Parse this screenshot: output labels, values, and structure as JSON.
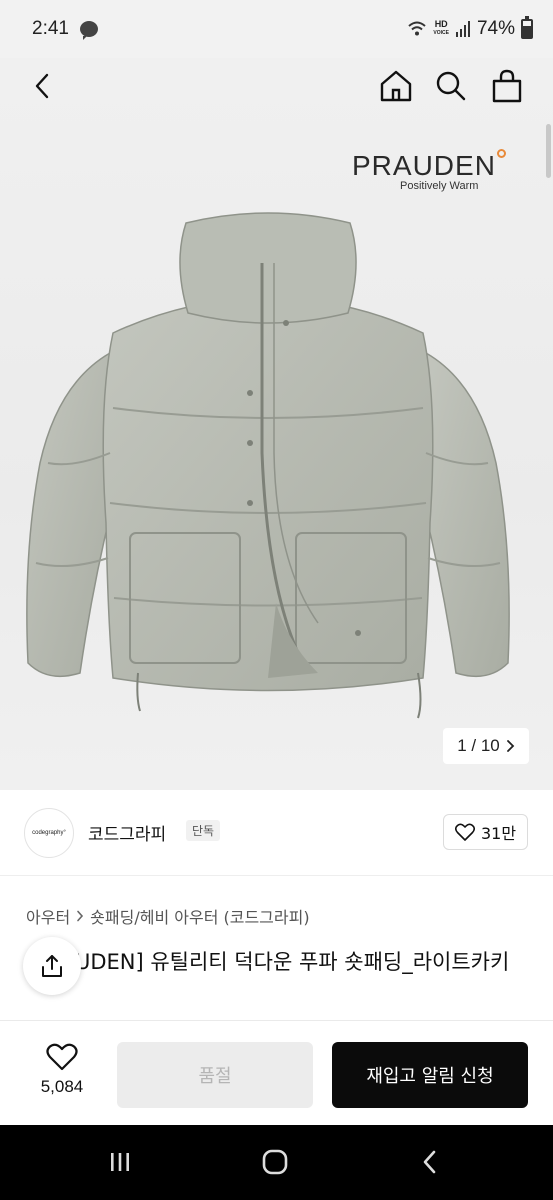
{
  "status_bar": {
    "time": "2:41",
    "talk_badge": "TALK",
    "network": "HD",
    "network_sub": "VOICE",
    "battery": "74%",
    "icons": [
      "wifi-icon",
      "signal-icon",
      "battery-icon"
    ]
  },
  "nav": {
    "icons": [
      "back-arrow-icon",
      "home-icon",
      "search-icon",
      "shopping-bag-icon"
    ]
  },
  "hero": {
    "brand_name": "PRAUDEN",
    "brand_tagline": "Positively Warm",
    "page_indicator": "1 / 10",
    "image_alt": "jacket"
  },
  "seller": {
    "avatar_text": "codegraphy°",
    "name": "코드그라피",
    "badge": "단독",
    "likes": "31만"
  },
  "product": {
    "breadcrumb": [
      "아우터",
      "숏패딩/헤비 아우터 (코드그라피)"
    ],
    "title": "[PRAUDEN] 유틸리티 덕다운 푸파 숏패딩_라이트카키"
  },
  "actions": {
    "wish_count": "5,084",
    "soldout_label": "품절",
    "restock_label": "재입고 알림 신청"
  },
  "colors": {
    "primary_button": "#0b0b0b",
    "disabled_button": "#ececec",
    "jacket": "#b6bab1",
    "brand_accent": "#e88a3a"
  }
}
